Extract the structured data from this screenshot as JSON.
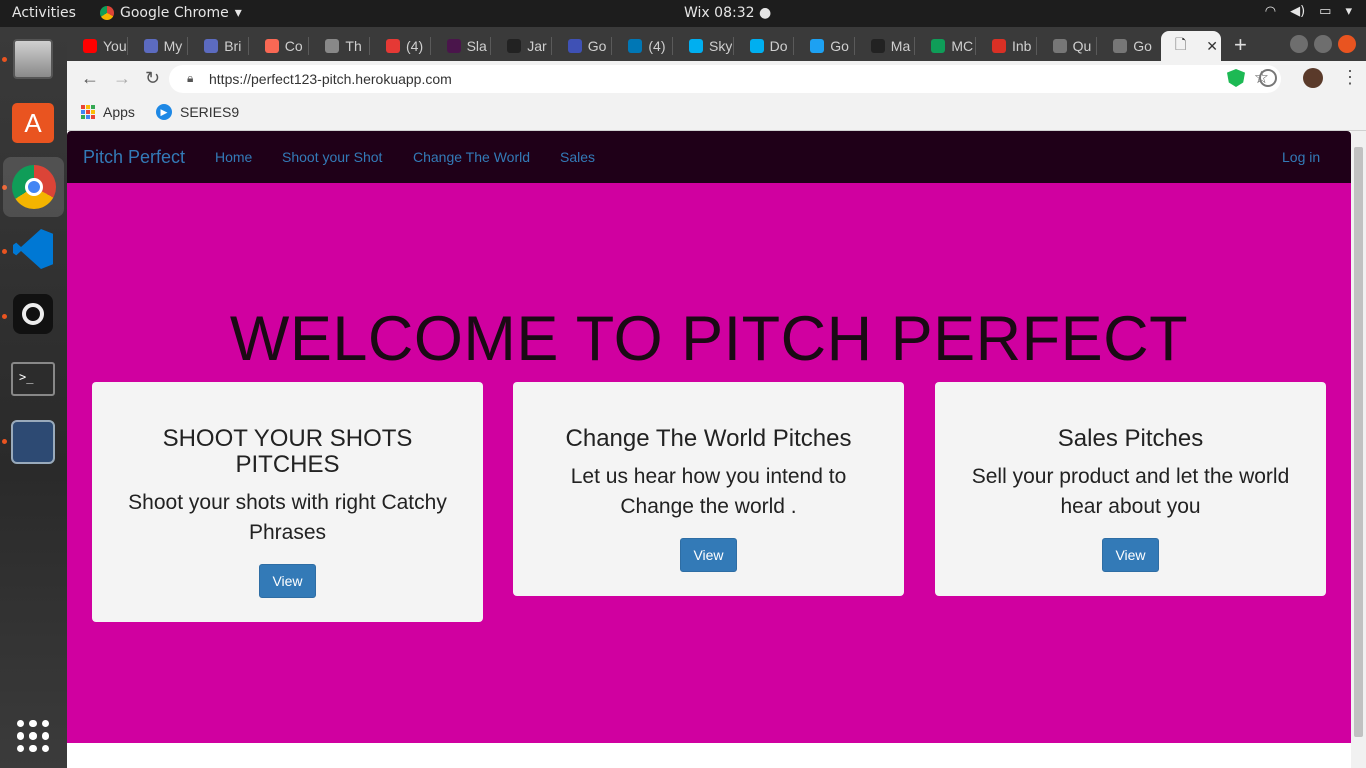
{
  "system_bar": {
    "activities": "Activities",
    "app_name": "Google Chrome",
    "clock": "Wix 08:32"
  },
  "browser": {
    "tabs": [
      {
        "label": "You",
        "color": "#ff0000"
      },
      {
        "label": "My",
        "color": "#5c6bc0"
      },
      {
        "label": "Bri",
        "color": "#5c6bc0"
      },
      {
        "label": "Co",
        "color": "#f96854"
      },
      {
        "label": "Th",
        "color": "#888888"
      },
      {
        "label": "(4)",
        "color": "#e53935"
      },
      {
        "label": "Sla",
        "color": "#4a154b"
      },
      {
        "label": "Jar",
        "color": "#222222"
      },
      {
        "label": "Go",
        "color": "#3f51b5"
      },
      {
        "label": "(4)",
        "color": "#0077b5"
      },
      {
        "label": "Sky",
        "color": "#00aff0"
      },
      {
        "label": "Do",
        "color": "#00aff0"
      },
      {
        "label": "Go",
        "color": "#1da1f2"
      },
      {
        "label": "Ma",
        "color": "#222222"
      },
      {
        "label": "MC",
        "color": "#0f9d58"
      },
      {
        "label": "Inb",
        "color": "#d93025"
      },
      {
        "label": "Qu",
        "color": "#777777"
      },
      {
        "label": "Go",
        "color": "#777777"
      }
    ],
    "url": "https://perfect123-pitch.herokuapp.com",
    "bookmarks": {
      "apps": "Apps",
      "series9": "SERIES9"
    }
  },
  "site": {
    "brand": "Pitch Perfect",
    "nav": {
      "home": "Home",
      "shoot": "Shoot your Shot",
      "change": "Change The World",
      "sales": "Sales",
      "login": "Log in"
    },
    "hero_title": "WELCOME TO PITCH PERFECT",
    "cards": [
      {
        "title": "SHOOT YOUR SHOTS PITCHES",
        "text": "Shoot your shots with right Catchy Phrases",
        "button": "View"
      },
      {
        "title": "Change The World Pitches",
        "text": "Let us hear how you intend to Change the world .",
        "button": "View"
      },
      {
        "title": "Sales Pitches",
        "text": "Sell your product and let the world hear about you",
        "button": "View"
      }
    ],
    "colors": {
      "navbar": "#1f0018",
      "hero": "#d000a0",
      "link": "#337ab7",
      "button": "#337ab7"
    }
  }
}
